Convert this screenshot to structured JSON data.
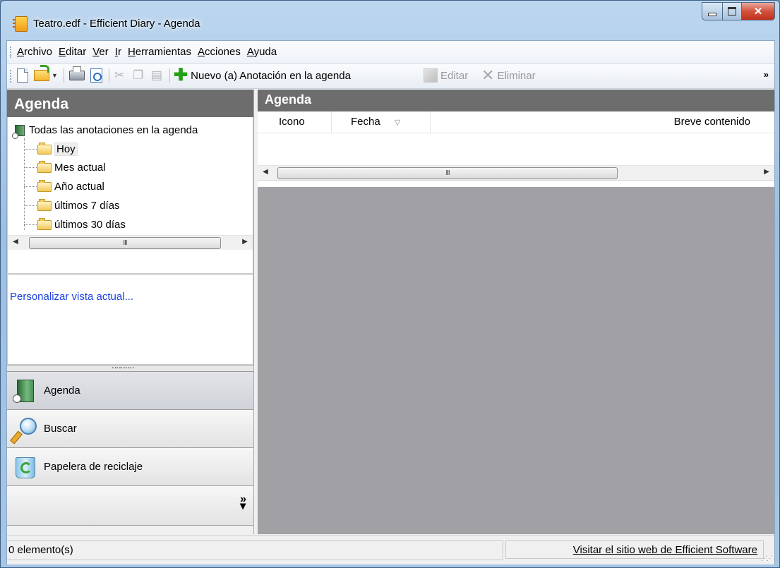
{
  "window": {
    "title": "Teatro.edf - Efficient Diary - Agenda"
  },
  "menu": [
    "Archivo",
    "Editar",
    "Ver",
    "Ir",
    "Herramientas",
    "Acciones",
    "Ayuda"
  ],
  "toolbar": {
    "new_entry_label": "Nuevo (a) Anotación en la agenda",
    "edit_label": "Editar",
    "delete_label": "Eliminar",
    "overflow_label": "»"
  },
  "left_panel": {
    "header": "Agenda",
    "tree": {
      "root": "Todas las anotaciones en la agenda",
      "items": [
        "Hoy",
        "Mes actual",
        "Año actual",
        "últimos 7 días",
        "últimos 30 días"
      ],
      "selected": "Hoy"
    },
    "customize_link": "Personalizar vista actual...",
    "nav": [
      {
        "label": "Agenda",
        "icon": "agenda-icon",
        "active": true
      },
      {
        "label": "Buscar",
        "icon": "search-icon",
        "active": false
      },
      {
        "label": "Papelera de reciclaje",
        "icon": "recycle-bin-icon",
        "active": false
      }
    ],
    "nav_more": "»"
  },
  "right_panel": {
    "header": "Agenda",
    "columns": [
      "Icono",
      "Fecha",
      "Breve contenido"
    ],
    "sort_indicator": "▽",
    "rows": []
  },
  "scroll_thumb_label": "III",
  "status": {
    "left": "0 elemento(s)",
    "right_link": "Visitar el sitio web de Efficient Software"
  },
  "colors": {
    "panel_header": "#6d6d6d",
    "content_bg": "#a1a1a5",
    "link": "#1a3fe0",
    "add_icon": "#22a014"
  }
}
